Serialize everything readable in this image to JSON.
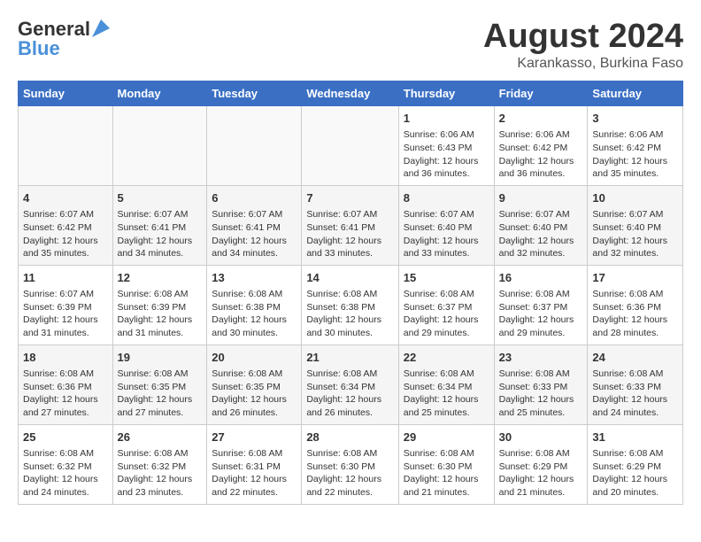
{
  "header": {
    "logo_general": "General",
    "logo_blue": "Blue",
    "main_title": "August 2024",
    "subtitle": "Karankasso, Burkina Faso"
  },
  "days_of_week": [
    "Sunday",
    "Monday",
    "Tuesday",
    "Wednesday",
    "Thursday",
    "Friday",
    "Saturday"
  ],
  "weeks": [
    [
      {
        "day": "",
        "content": ""
      },
      {
        "day": "",
        "content": ""
      },
      {
        "day": "",
        "content": ""
      },
      {
        "day": "",
        "content": ""
      },
      {
        "day": "1",
        "content": "Sunrise: 6:06 AM\nSunset: 6:43 PM\nDaylight: 12 hours and 36 minutes."
      },
      {
        "day": "2",
        "content": "Sunrise: 6:06 AM\nSunset: 6:42 PM\nDaylight: 12 hours and 36 minutes."
      },
      {
        "day": "3",
        "content": "Sunrise: 6:06 AM\nSunset: 6:42 PM\nDaylight: 12 hours and 35 minutes."
      }
    ],
    [
      {
        "day": "4",
        "content": "Sunrise: 6:07 AM\nSunset: 6:42 PM\nDaylight: 12 hours and 35 minutes."
      },
      {
        "day": "5",
        "content": "Sunrise: 6:07 AM\nSunset: 6:41 PM\nDaylight: 12 hours and 34 minutes."
      },
      {
        "day": "6",
        "content": "Sunrise: 6:07 AM\nSunset: 6:41 PM\nDaylight: 12 hours and 34 minutes."
      },
      {
        "day": "7",
        "content": "Sunrise: 6:07 AM\nSunset: 6:41 PM\nDaylight: 12 hours and 33 minutes."
      },
      {
        "day": "8",
        "content": "Sunrise: 6:07 AM\nSunset: 6:40 PM\nDaylight: 12 hours and 33 minutes."
      },
      {
        "day": "9",
        "content": "Sunrise: 6:07 AM\nSunset: 6:40 PM\nDaylight: 12 hours and 32 minutes."
      },
      {
        "day": "10",
        "content": "Sunrise: 6:07 AM\nSunset: 6:40 PM\nDaylight: 12 hours and 32 minutes."
      }
    ],
    [
      {
        "day": "11",
        "content": "Sunrise: 6:07 AM\nSunset: 6:39 PM\nDaylight: 12 hours and 31 minutes."
      },
      {
        "day": "12",
        "content": "Sunrise: 6:08 AM\nSunset: 6:39 PM\nDaylight: 12 hours and 31 minutes."
      },
      {
        "day": "13",
        "content": "Sunrise: 6:08 AM\nSunset: 6:38 PM\nDaylight: 12 hours and 30 minutes."
      },
      {
        "day": "14",
        "content": "Sunrise: 6:08 AM\nSunset: 6:38 PM\nDaylight: 12 hours and 30 minutes."
      },
      {
        "day": "15",
        "content": "Sunrise: 6:08 AM\nSunset: 6:37 PM\nDaylight: 12 hours and 29 minutes."
      },
      {
        "day": "16",
        "content": "Sunrise: 6:08 AM\nSunset: 6:37 PM\nDaylight: 12 hours and 29 minutes."
      },
      {
        "day": "17",
        "content": "Sunrise: 6:08 AM\nSunset: 6:36 PM\nDaylight: 12 hours and 28 minutes."
      }
    ],
    [
      {
        "day": "18",
        "content": "Sunrise: 6:08 AM\nSunset: 6:36 PM\nDaylight: 12 hours and 27 minutes."
      },
      {
        "day": "19",
        "content": "Sunrise: 6:08 AM\nSunset: 6:35 PM\nDaylight: 12 hours and 27 minutes."
      },
      {
        "day": "20",
        "content": "Sunrise: 6:08 AM\nSunset: 6:35 PM\nDaylight: 12 hours and 26 minutes."
      },
      {
        "day": "21",
        "content": "Sunrise: 6:08 AM\nSunset: 6:34 PM\nDaylight: 12 hours and 26 minutes."
      },
      {
        "day": "22",
        "content": "Sunrise: 6:08 AM\nSunset: 6:34 PM\nDaylight: 12 hours and 25 minutes."
      },
      {
        "day": "23",
        "content": "Sunrise: 6:08 AM\nSunset: 6:33 PM\nDaylight: 12 hours and 25 minutes."
      },
      {
        "day": "24",
        "content": "Sunrise: 6:08 AM\nSunset: 6:33 PM\nDaylight: 12 hours and 24 minutes."
      }
    ],
    [
      {
        "day": "25",
        "content": "Sunrise: 6:08 AM\nSunset: 6:32 PM\nDaylight: 12 hours and 24 minutes."
      },
      {
        "day": "26",
        "content": "Sunrise: 6:08 AM\nSunset: 6:32 PM\nDaylight: 12 hours and 23 minutes."
      },
      {
        "day": "27",
        "content": "Sunrise: 6:08 AM\nSunset: 6:31 PM\nDaylight: 12 hours and 22 minutes."
      },
      {
        "day": "28",
        "content": "Sunrise: 6:08 AM\nSunset: 6:30 PM\nDaylight: 12 hours and 22 minutes."
      },
      {
        "day": "29",
        "content": "Sunrise: 6:08 AM\nSunset: 6:30 PM\nDaylight: 12 hours and 21 minutes."
      },
      {
        "day": "30",
        "content": "Sunrise: 6:08 AM\nSunset: 6:29 PM\nDaylight: 12 hours and 21 minutes."
      },
      {
        "day": "31",
        "content": "Sunrise: 6:08 AM\nSunset: 6:29 PM\nDaylight: 12 hours and 20 minutes."
      }
    ]
  ]
}
